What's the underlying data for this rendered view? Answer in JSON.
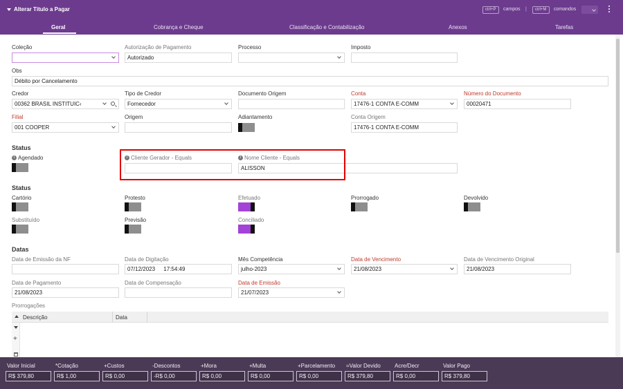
{
  "window": {
    "title": "Alterar Título a Pagar"
  },
  "header_hints": {
    "kbd1": "ctrl+P",
    "kbd1_text": "campos",
    "separator": "|",
    "kbd2": "ctrl+M",
    "kbd2_text": "comandos"
  },
  "tabs": [
    "Geral",
    "Cobrança e Cheque",
    "Classificação e Contabilização",
    "Anexos",
    "Tarefas"
  ],
  "fields": {
    "colecao": {
      "label": "Coleção",
      "value": ""
    },
    "autorizacao": {
      "label": "Autorização de Pagamento",
      "value": "Autorizado"
    },
    "processo": {
      "label": "Processo",
      "value": ""
    },
    "imposto": {
      "label": "Imposto",
      "value": ""
    },
    "obs": {
      "label": "Obs",
      "value": "Débito por Cancelamento"
    },
    "credor": {
      "label": "Credor",
      "value": "00362 BRASIL INSTITUIC‹"
    },
    "tipo_credor": {
      "label": "Tipo de Credor",
      "value": "Fornecedor"
    },
    "documento_origem": {
      "label": "Documento Origem",
      "value": ""
    },
    "conta": {
      "label": "Conta",
      "value": "17476-1 CONTA E-COMM"
    },
    "numero_documento": {
      "label": "Número do Documento",
      "value": "00020471"
    },
    "filial": {
      "label": "Filial",
      "value": "001 COOPER"
    },
    "origem": {
      "label": "Origem",
      "value": ""
    },
    "adiantamento": {
      "label": "Adiantamento"
    },
    "conta_origem": {
      "label": "Conta Origem",
      "value": "17476-1 CONTA  E-COMM"
    }
  },
  "status1": {
    "heading": "Status",
    "agendado": "Agendado",
    "cliente_gerador": {
      "label": "Cliente Gerador - Equals",
      "value": ""
    },
    "nome_cliente": {
      "label": "Nome Cliente - Equals",
      "value": "ALISSON"
    }
  },
  "status2": {
    "heading": "Status",
    "toggles": [
      {
        "label": "Cartório",
        "on": false
      },
      {
        "label": "Protesto",
        "on": false
      },
      {
        "label": "Efetuado",
        "on": true
      },
      {
        "label": "Prorrogado",
        "on": false
      },
      {
        "label": "Devolvido",
        "on": false
      },
      {
        "label": "Substituído",
        "on": false
      },
      {
        "label": "Previsão",
        "on": false
      },
      {
        "label": "Conciliado",
        "on": true
      }
    ]
  },
  "datas": {
    "heading": "Datas",
    "emissao_nf": {
      "label": "Data de Emissão da NF",
      "value": ""
    },
    "digitacao": {
      "label": "Data de Digitação",
      "date": "07/12/2023",
      "time": "17:54:49"
    },
    "mes_competencia": {
      "label": "Mês Competência",
      "value": "julho-2023"
    },
    "vencimento": {
      "label": "Data de Vencimento",
      "value": "21/08/2023"
    },
    "vencimento_original": {
      "label": "Data de Vencimento Original",
      "value": "21/08/2023"
    },
    "pagamento": {
      "label": "Data de Pagamento",
      "value": "21/08/2023"
    },
    "compensacao": {
      "label": "Data de Compensação",
      "value": ""
    },
    "emissao": {
      "label": "Data de Emissão",
      "value": "21/07/2023"
    }
  },
  "prorrogacoes": {
    "label": "Prorrogações",
    "columns": [
      "Descrição",
      "Data"
    ]
  },
  "footer": [
    {
      "label": "Valor Inicial",
      "value": "R$ 379,80"
    },
    {
      "label": "*Cotação",
      "value": "R$ 1,00"
    },
    {
      "label": "+Custos",
      "value": "R$ 0,00"
    },
    {
      "label": "-Descontos",
      "value": "-R$ 0,00"
    },
    {
      "label": "+Mora",
      "value": "R$ 0,00"
    },
    {
      "label": "+Multa",
      "value": "R$ 0,00"
    },
    {
      "label": "+Parcelamento",
      "value": "R$ 0,00"
    },
    {
      "label": "=Valor Devido",
      "value": "R$ 379,80"
    },
    {
      "label": "Acre/Decr",
      "value": "R$ 0,00"
    },
    {
      "label": "Valor Pago",
      "value": "R$ 379,80"
    }
  ],
  "colors": {
    "header": "#6c3b8e",
    "footer": "#4b3a55",
    "toggle_on": "#a342d6",
    "required": "#c0392b",
    "highlight": "#e00000"
  }
}
